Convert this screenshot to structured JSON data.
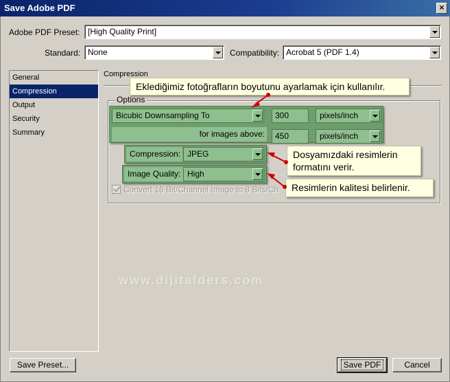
{
  "window": {
    "title": "Save Adobe PDF",
    "close_glyph": "×"
  },
  "preset": {
    "label": "Adobe PDF Preset:",
    "value": "[High Quality Print]"
  },
  "standard": {
    "label": "Standard:",
    "value": "None"
  },
  "compatibility": {
    "label": "Compatibility:",
    "value": "Acrobat 5 (PDF 1.4)"
  },
  "sidebar": {
    "items": [
      {
        "label": "General",
        "selected": false
      },
      {
        "label": "Compression",
        "selected": true
      },
      {
        "label": "Output",
        "selected": false
      },
      {
        "label": "Security",
        "selected": false
      },
      {
        "label": "Summary",
        "selected": false
      }
    ]
  },
  "panel": {
    "title": "Compression",
    "options_group": "Options",
    "downsampling": {
      "method": "Bicubic Downsampling To",
      "resolution": "300",
      "resolution_unit": "pixels/inch",
      "above_label": "for images above:",
      "above_value": "450",
      "above_unit": "pixels/inch"
    },
    "compression": {
      "label": "Compression:",
      "value": "JPEG"
    },
    "quality": {
      "label": "Image Quality:",
      "value": "High"
    },
    "convert_16bit": {
      "label": "Convert 16 Bit/Channel Image to 8 Bits/Ch",
      "checked": true,
      "enabled": false
    }
  },
  "callouts": {
    "downsampling": "Eklediğimiz fotoğrafların boyutunu ayarlamak için kullanılır.",
    "compression_line1": "Dosyamızdaki resimlerin",
    "compression_line2": "formatını verir.",
    "quality": "Resimlerin kalitesi belirlenir."
  },
  "watermark": "www.dijitalders.com",
  "buttons": {
    "save_preset": "Save Preset...",
    "save_pdf": "Save PDF",
    "cancel": "Cancel"
  },
  "colors": {
    "title_bar": "#0a246a",
    "highlight_green": "#8fbf8f",
    "callout_bg": "#ffffe1",
    "arrow_red": "#cc0000"
  }
}
